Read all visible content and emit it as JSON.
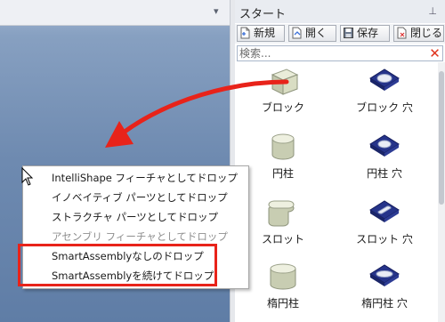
{
  "panel": {
    "title": "スタート",
    "pin_glyph": "ㅁ"
  },
  "toolbar": {
    "new_label": "新規",
    "open_label": "開く",
    "save_label": "保存",
    "close_label": "閉じる"
  },
  "search": {
    "placeholder": "検索...",
    "clear_glyph": "✕"
  },
  "catalog": {
    "items": [
      {
        "label": "ブロック",
        "icon": "block-icon"
      },
      {
        "label": "ブロック 穴",
        "icon": "block-hole-icon"
      },
      {
        "label": "円柱",
        "icon": "cylinder-icon"
      },
      {
        "label": "円柱 穴",
        "icon": "cylinder-hole-icon"
      },
      {
        "label": "スロット",
        "icon": "slot-icon"
      },
      {
        "label": "スロット 穴",
        "icon": "slot-hole-icon"
      },
      {
        "label": "楕円柱",
        "icon": "elliptic-cylinder-icon"
      },
      {
        "label": "楕円柱 穴",
        "icon": "elliptic-cylinder-hole-icon"
      }
    ]
  },
  "context_menu": {
    "items": [
      {
        "label": "IntelliShape フィーチャとしてドロップ",
        "enabled": true
      },
      {
        "label": "イノベイティブ パーツとしてドロップ",
        "enabled": true
      },
      {
        "label": "ストラクチャ パーツとしてドロップ",
        "enabled": true
      },
      {
        "label": "アセンブリ フィーチャとしてドロップ",
        "enabled": false
      },
      {
        "label": "SmartAssemblyなしのドロップ",
        "enabled": true
      },
      {
        "label": "SmartAssemblyを続けてドロップ",
        "enabled": true
      }
    ]
  },
  "colors": {
    "annotation_red": "#e8231a",
    "viewport_blue": "#6e8ab0",
    "icon_navy": "#1f2b7a"
  }
}
